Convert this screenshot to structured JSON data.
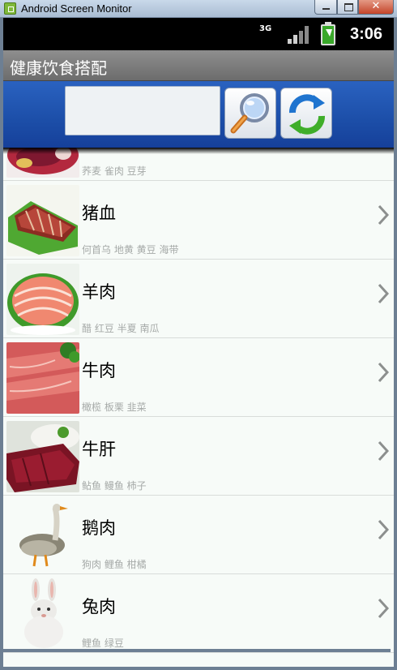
{
  "window": {
    "title": "Android Screen Monitor",
    "close_glyph": "✕"
  },
  "status_bar": {
    "network": "3G",
    "time": "3:06"
  },
  "app": {
    "title": "健康饮食搭配"
  },
  "search": {
    "value": "",
    "placeholder": "",
    "search_icon": "magnifier-icon",
    "refresh_icon": "refresh-icon"
  },
  "list": {
    "items": [
      {
        "name": "",
        "pairings": "荞麦 雀肉 豆芽",
        "image": "meat-thumbnail"
      },
      {
        "name": "猪血",
        "pairings": "何首乌 地黄 黄豆 海带",
        "image": "pork-blood-thumbnail"
      },
      {
        "name": "羊肉",
        "pairings": "醋 红豆 半夏 南瓜",
        "image": "mutton-thumbnail"
      },
      {
        "name": "牛肉",
        "pairings": "橄榄 板栗 韭菜",
        "image": "beef-thumbnail"
      },
      {
        "name": "牛肝",
        "pairings": "鲇鱼 鳗鱼 柿子",
        "image": "beef-liver-thumbnail"
      },
      {
        "name": "鹅肉",
        "pairings": "狗肉 鲤鱼 柑橘",
        "image": "goose-thumbnail"
      },
      {
        "name": "兔肉",
        "pairings": "鲤鱼 绿豆",
        "image": "rabbit-thumbnail"
      }
    ]
  },
  "colors": {
    "search_bar": "#1c4ea8",
    "title_bar": "#7b7b7b",
    "list_background": "#f7fbf8",
    "secondary_text": "#a6aaa8"
  }
}
